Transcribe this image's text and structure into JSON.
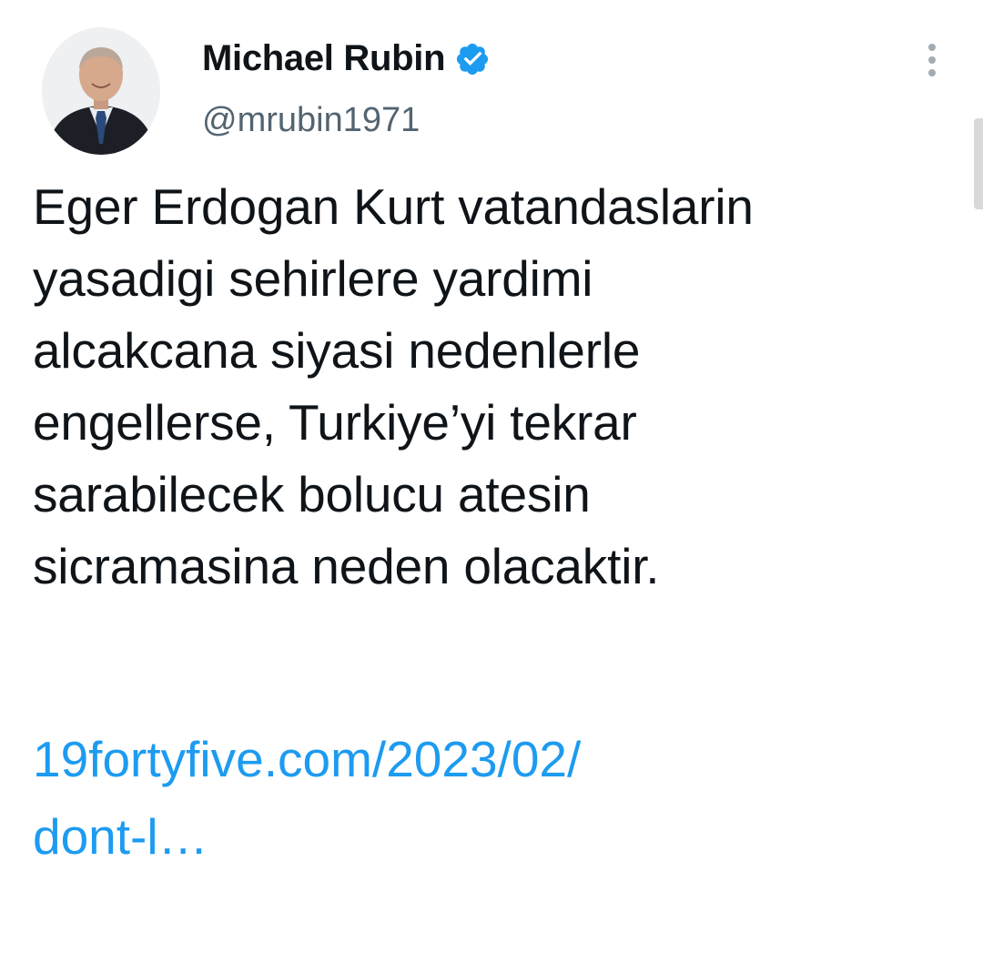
{
  "author": {
    "display_name": "Michael Rubin",
    "handle": "@mrubin1971",
    "verified": true,
    "avatar_icon": "profile-photo"
  },
  "tweet": {
    "text_lines": [
      "Eger Erdogan Kurt vatandaslarin",
      "yasadigi sehirlere yardimi",
      "alcakcana siyasi nedenlerle",
      "engellerse, Turkiye’yi tekrar",
      "sarabilecek bolucu atesin",
      "sicramasina neden olacaktir."
    ],
    "link_lines": [
      "19fortyfive.com/2023/02/",
      "dont-l…"
    ]
  },
  "icons": {
    "verified": "verified-badge-icon",
    "more": "more-options-icon"
  },
  "colors": {
    "link": "#1d9bf0",
    "verified": "#1d9bf0",
    "secondary_text": "#536471",
    "primary_text": "#0f1419"
  }
}
